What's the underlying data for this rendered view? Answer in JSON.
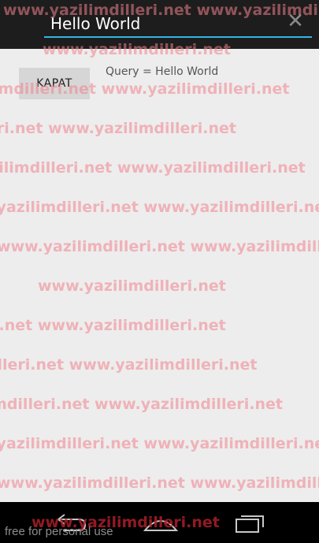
{
  "search": {
    "value": "Hello World"
  },
  "content": {
    "close_button_label": "KAPAT",
    "query_text": "Query = Hello World"
  },
  "watermark": {
    "text": "www.yazilimdilleri.net",
    "rows": [
      "www.yazilimdilleri.net      www.yazilimdilleri.net",
      "www.yazilimdilleri.net",
      "ilimdilleri.net      www.yazilimdilleri.net",
      "lleri.net      www.yazilimdilleri.net",
      "yazilimdilleri.net      www.yazilimdilleri.net",
      "w.yazilimdilleri.net      www.yazilimdilleri.net",
      "www.yazilimdilleri.net      www.yazilimdilleri.net",
      "www.yazilimdilleri.net",
      "i.net      www.yazilimdilleri.net",
      "illeri.net      www.yazilimdilleri.net",
      "limdilleri.net      www.yazilimdilleri.net",
      "w.yazilimdilleri.net      www.yazilimdilleri.net",
      "www.yazilimdilleri.net      www.yazilimdilleri.net",
      "www.yazilimdilleri.net"
    ]
  },
  "nav": {
    "back_icon": "back-arrow-icon",
    "home_icon": "home-icon",
    "recents_icon": "recent-apps-icon"
  },
  "footer": {
    "note": "free for personal use"
  },
  "colors": {
    "accent": "#33b5e5",
    "action_bar": "#1d1d1d",
    "content_bg": "#ededed",
    "button_bg": "#d6d6d6",
    "watermark": "#f0828c",
    "nav_bar": "#000000"
  }
}
